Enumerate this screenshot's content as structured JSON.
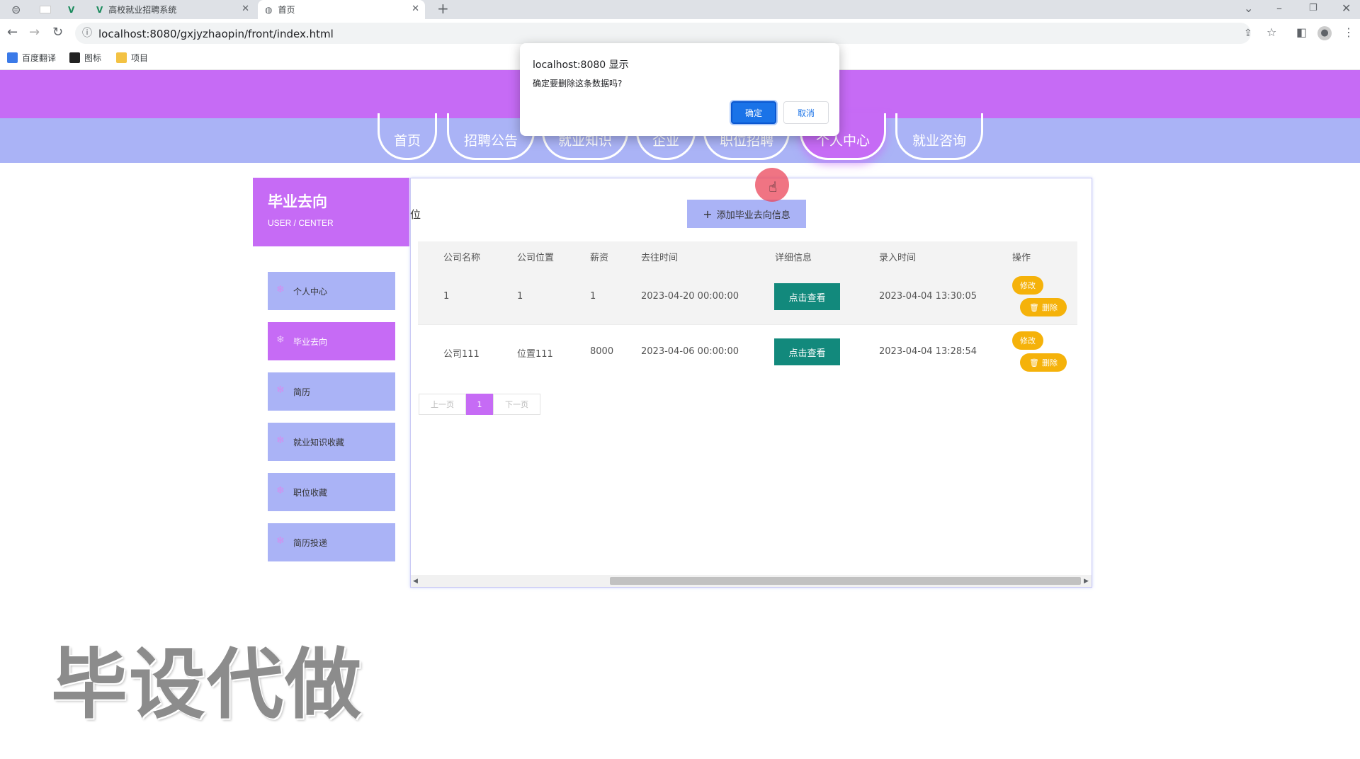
{
  "browser": {
    "tabs": [
      {
        "label": "",
        "icon": "blank-icon"
      },
      {
        "label": "高校就业招聘系统",
        "icon": "vue-icon"
      },
      {
        "label": "首页",
        "icon": "globe-icon",
        "active": true
      }
    ],
    "url": "localhost:8080/gxjyzhaopin/front/index.html",
    "bookmarks": [
      {
        "label": "百度翻译",
        "color": "#3b7ae8"
      },
      {
        "label": "图标",
        "color": "#222222"
      },
      {
        "label": "项目",
        "color": "#f3c243"
      }
    ]
  },
  "nav": {
    "items": [
      "首页",
      "招聘公告",
      "就业知识",
      "企业",
      "职位招聘",
      "个人中心",
      "就业咨询"
    ],
    "active": "个人中心"
  },
  "sidebar": {
    "title": "毕业去向",
    "subtitle": "USER / CENTER",
    "items": [
      "个人中心",
      "毕业去向",
      "简历",
      "就业知识收藏",
      "职位收藏",
      "简历投递"
    ],
    "active": "毕业去向"
  },
  "main": {
    "partial_label": "位",
    "add_button": "添加毕业去向信息",
    "columns": [
      "公司名称",
      "公司位置",
      "薪资",
      "去往时间",
      "详细信息",
      "录入时间",
      "操作"
    ],
    "rows": [
      {
        "company": "1",
        "location": "1",
        "salary": "1",
        "goto_time": "2023-04-20 00:00:00",
        "detail": "点击查看",
        "entry_time": "2023-04-04 13:30:05",
        "edit": "修改",
        "delete": "删除"
      },
      {
        "company": "公司111",
        "location": "位置111",
        "salary": "8000",
        "goto_time": "2023-04-06 00:00:00",
        "detail": "点击查看",
        "entry_time": "2023-04-04 13:28:54",
        "edit": "修改",
        "delete": "删除"
      }
    ],
    "pagination": {
      "prev": "上一页",
      "current": "1",
      "next": "下一页"
    }
  },
  "dialog": {
    "title": "localhost:8080 显示",
    "message": "确定要删除这条数据吗?",
    "ok": "确定",
    "cancel": "取消"
  },
  "watermark": "毕设代做",
  "colors": {
    "primary": "#c66bf5",
    "secondary": "#aab3f6",
    "view": "#12897c",
    "action": "#f5b20a"
  }
}
